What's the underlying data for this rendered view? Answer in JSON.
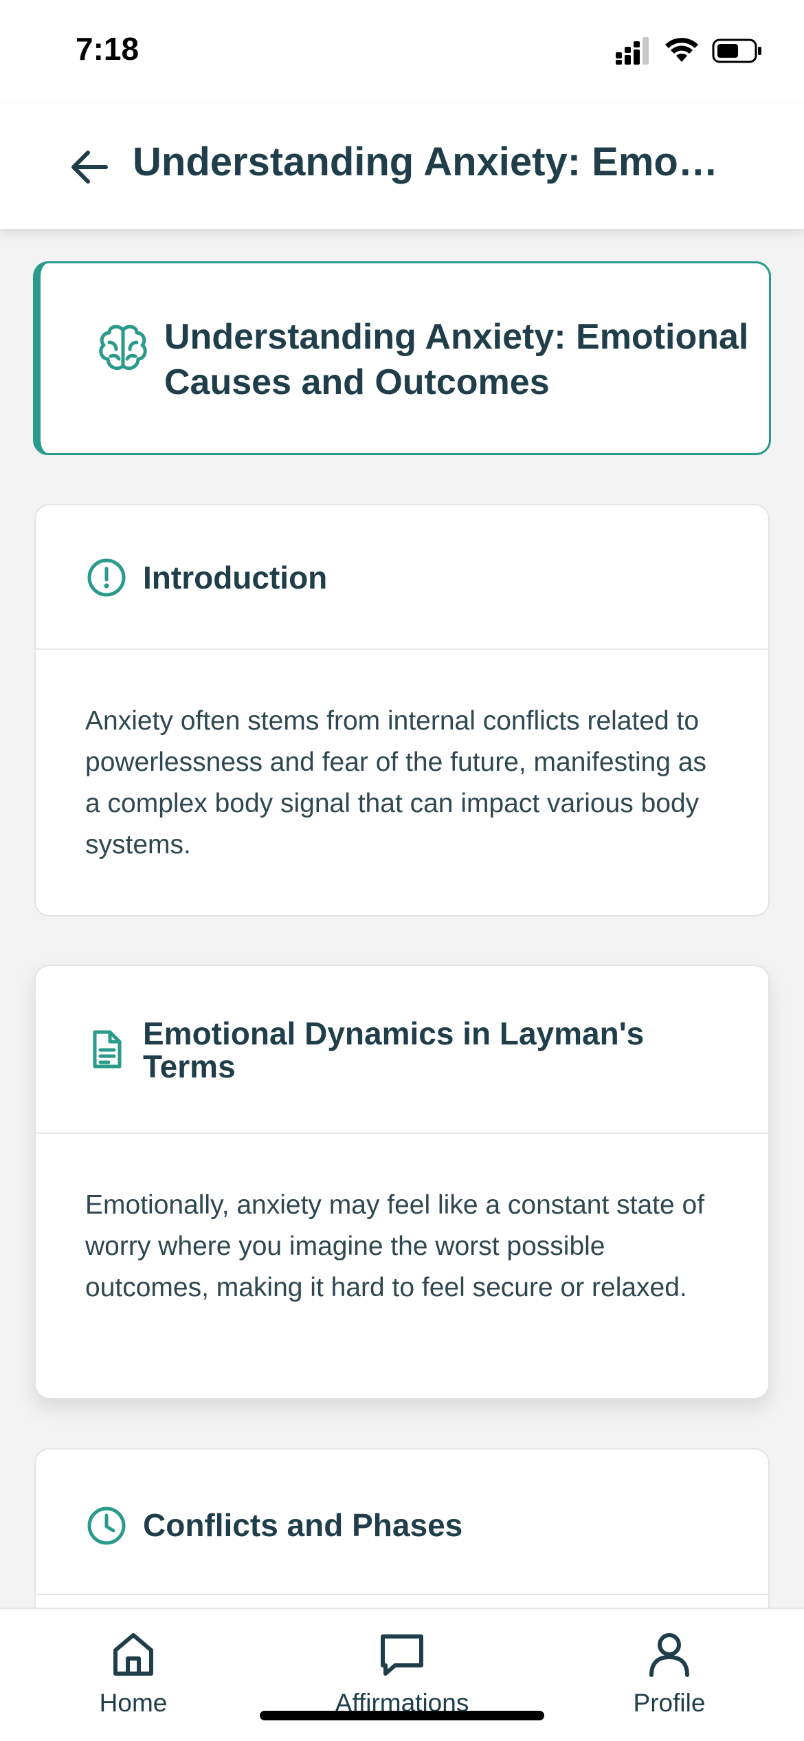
{
  "status_bar": {
    "time": "7:18"
  },
  "header": {
    "title": "Understanding Anxiety: Emo…"
  },
  "hero": {
    "title": "Understanding Anxiety: Emotional Causes and Outcomes",
    "icon": "brain-icon"
  },
  "sections": [
    {
      "title": "Introduction",
      "icon": "alert-circle-icon",
      "body": "Anxiety often stems from internal conflicts related to powerlessness and fear of the future, manifesting as a complex body signal that can impact various body systems."
    },
    {
      "title": "Emotional Dynamics in Layman's Terms",
      "icon": "document-icon",
      "body": "Emotionally, anxiety may feel like a constant state of worry where you imagine the worst possible outcomes, making it hard to feel secure or relaxed."
    },
    {
      "title": "Conflicts and Phases",
      "icon": "clock-icon",
      "body": ""
    }
  ],
  "bottom_nav": {
    "items": [
      {
        "label": "Home",
        "icon": "home-icon"
      },
      {
        "label": "Affirmations",
        "icon": "chat-bubble-icon"
      },
      {
        "label": "Profile",
        "icon": "user-icon"
      }
    ]
  },
  "colors": {
    "accent": "#2a9a8a",
    "text": "#1f3e4a",
    "background": "#f3f3f3"
  }
}
